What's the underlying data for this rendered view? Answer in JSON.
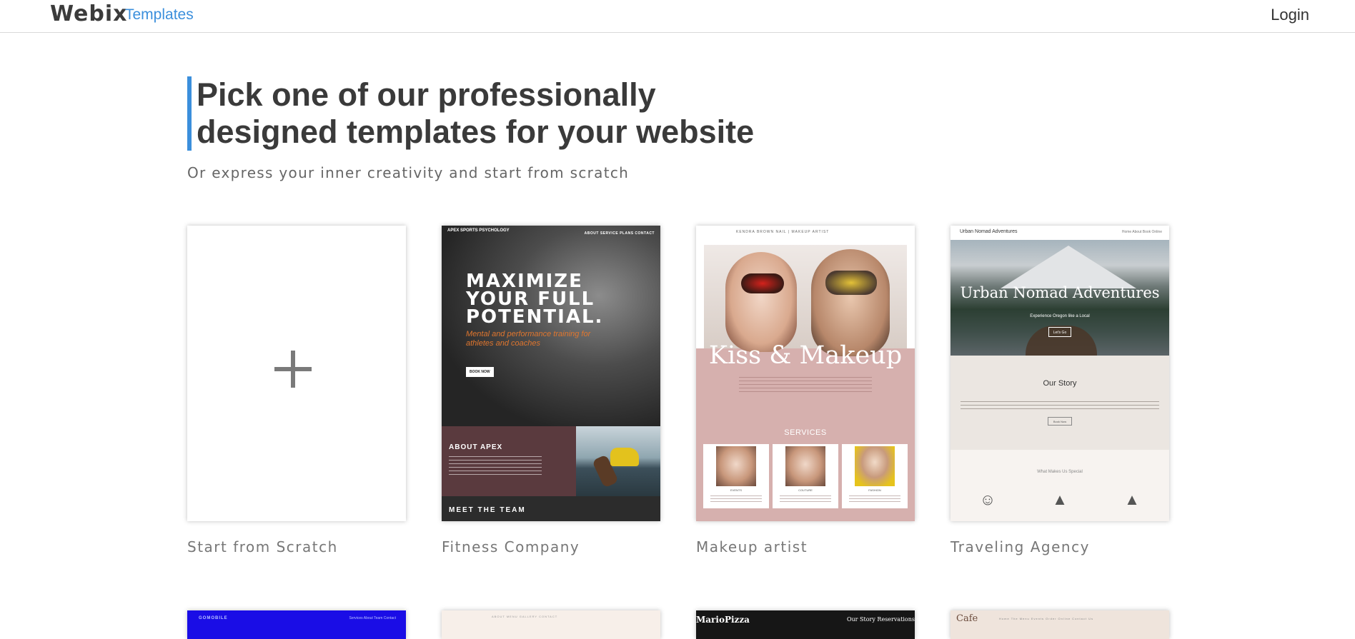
{
  "header": {
    "logo": "Webix",
    "nav_templates": "Templates",
    "login": "Login"
  },
  "hero": {
    "title": "Pick one of our professionally designed templates for your website",
    "subtitle": "Or express your inner creativity and start from scratch"
  },
  "templates": [
    {
      "label": "Start from Scratch"
    },
    {
      "label": "Fitness Company",
      "preview": {
        "logo": "APEX SPORTS PSYCHOLOGY",
        "nav": "ABOUT  SERVICE  PLANS  CONTACT",
        "title": "MAXIMIZE YOUR FULL POTENTIAL.",
        "subtitle": "Mental and performance training for athletes and coaches",
        "button": "BOOK NOW",
        "about_heading": "ABOUT APEX",
        "team_heading": "MEET THE TEAM"
      }
    },
    {
      "label": "Makeup artist",
      "preview": {
        "nav": "KENDRA BROWN NAIL | MAKEUP ARTIST",
        "title": "Kiss & Makeup",
        "services_heading": "SERVICES",
        "services": [
          "EVENTS",
          "COUTURE",
          "FASHION"
        ]
      }
    },
    {
      "label": "Traveling Agency",
      "preview": {
        "brand": "Urban Nomad Adventures",
        "nav": "Home   About   Book Online",
        "title": "Urban Nomad Adventures",
        "subtitle": "Experience Oregon like a Local",
        "button": "Let's Go",
        "story_heading": "Our Story",
        "story_button": "Book Now",
        "special_heading": "What Makes Us Special"
      }
    }
  ],
  "second_row": [
    {
      "title": "GOMOBILE",
      "nav": "Services   About   Team   Contact"
    },
    {
      "nav": "ABOUT   MENU   GALLERY   CONTACT"
    },
    {
      "title": "MarioPizza",
      "nav": "Our Story   Reservations"
    },
    {
      "title": "Cafe",
      "nav": "Home   The Menu   Events   Order Online   Contact Us"
    }
  ],
  "colors": {
    "accent": "#3b8fdc",
    "heading": "#3a3a3a",
    "muted": "#777777"
  }
}
